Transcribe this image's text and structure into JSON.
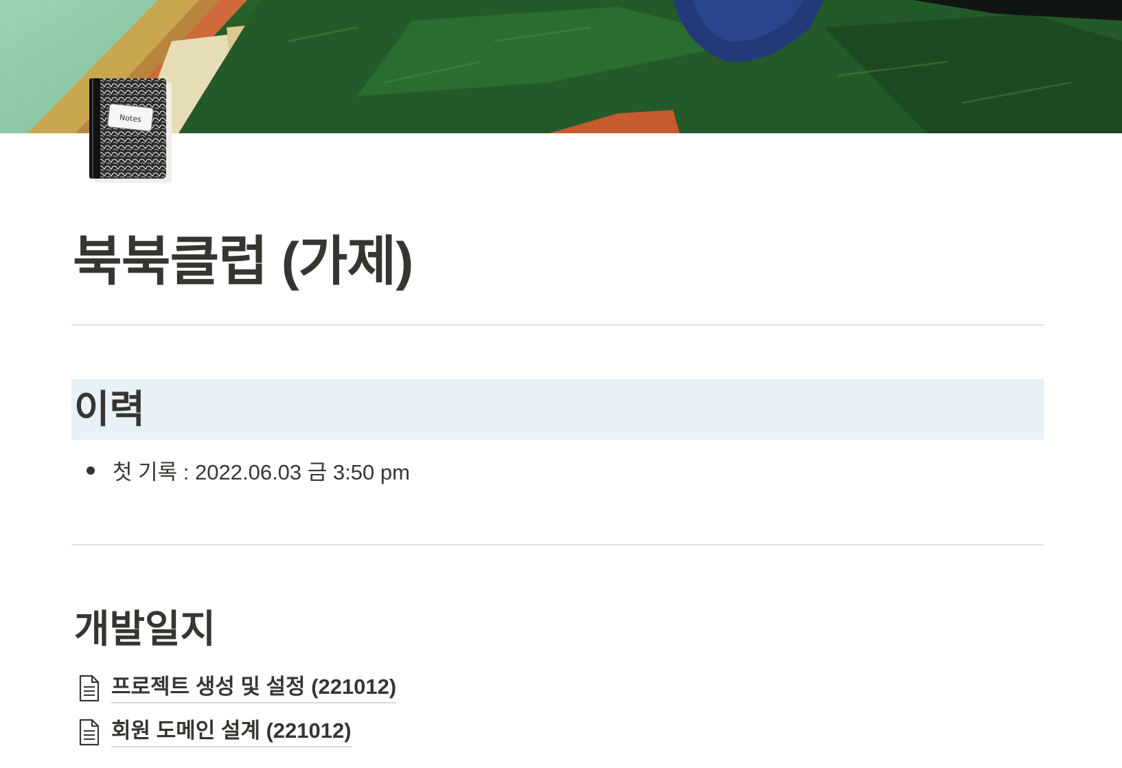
{
  "cover": {
    "description_icon": "painting-cover-image",
    "colors": {
      "mint": "#8fcba8",
      "green_dark": "#1e4a24",
      "green_mid": "#2f6a32",
      "ochre": "#c8a24a",
      "orange": "#d0693a",
      "blue": "#233a7a"
    }
  },
  "page": {
    "icon": "composition-notebook-icon",
    "icon_label": "Notes",
    "title": "북북클럽 (가제)"
  },
  "history": {
    "heading": "이력",
    "heading_bg": "#e7f1f6",
    "items": [
      {
        "text": "첫 기록 : 2022.06.03 금 3:50 pm"
      }
    ]
  },
  "devlog": {
    "heading": "개발일지",
    "links": [
      {
        "icon": "page-document-icon",
        "label": "프로젝트 생성 및 설정 (221012)"
      },
      {
        "icon": "page-document-icon",
        "label": "회원 도메인 설계 (221012)"
      }
    ]
  }
}
